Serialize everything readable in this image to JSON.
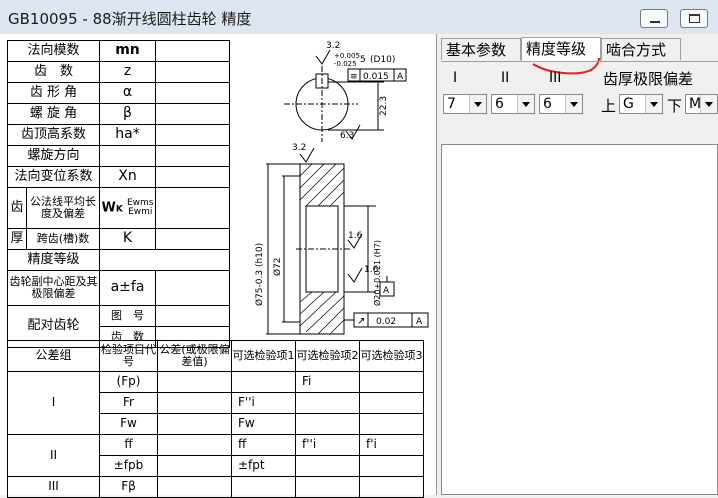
{
  "window": {
    "title": "GB10095 - 88渐开线圆柱齿轮 精度"
  },
  "spec_table": {
    "rows": [
      {
        "label": "法向模数",
        "symbol": "mn"
      },
      {
        "label": "齿　数",
        "symbol": "z"
      },
      {
        "label": "齿 形 角",
        "symbol": "α"
      },
      {
        "label": "螺 旋 角",
        "symbol": "β"
      },
      {
        "label": "齿顶高系数",
        "symbol": "ha*"
      },
      {
        "label": "螺旋方向",
        "symbol": ""
      },
      {
        "label": "法向变位系数",
        "symbol": "Xn"
      }
    ],
    "tooth_label_1": "齿",
    "tooth_label_2": "厚",
    "wk_label": "公法线平均长度及偏差",
    "wk_symbol": "W",
    "wk_sub": "K",
    "wk_ews": "Ewms",
    "wk_ewi": "Ewmi",
    "span_label": "跨齿(槽)数",
    "span_symbol": "K",
    "accuracy_label": "精度等级",
    "center_label": "齿轮副中心距及其极限偏差",
    "center_symbol": "a±fa",
    "mating_label": "配对齿轮",
    "drawing_no": "图　号",
    "teeth_count": "齿　数"
  },
  "tolerance_table": {
    "headers": [
      "公差组",
      "检验项目代号",
      "公差(或极限偏差值)",
      "可选检验项1",
      "可选检验项2",
      "可选检验项3"
    ],
    "groups": [
      {
        "name": "I",
        "items": [
          {
            "code": "(Fp)",
            "opt1": "",
            "opt2": "Fi",
            "opt3": ""
          },
          {
            "code": "Fr",
            "opt1": "F''i",
            "opt2": "",
            "opt3": ""
          },
          {
            "code": "Fw",
            "opt1": "Fw",
            "opt2": "",
            "opt3": ""
          }
        ]
      },
      {
        "name": "II",
        "items": [
          {
            "code": "ff",
            "opt1": "ff",
            "opt2": "f''i",
            "opt3": "f'i"
          },
          {
            "code": "±fpb",
            "opt1": "±fpt",
            "opt2": "",
            "opt3": ""
          }
        ]
      },
      {
        "name": "III",
        "items": [
          {
            "code": "Fβ",
            "opt1": "",
            "opt2": "",
            "opt3": ""
          }
        ]
      }
    ]
  },
  "drawing": {
    "roughness_1": "3.2",
    "roughness_2": "3.2",
    "roughness_3": "6.3",
    "roughness_4": "1.6",
    "roughness_5": "1.6",
    "tol_upper": "+0.005",
    "tol_lower": "-0.025",
    "keyway_dim": "5",
    "keyway_fit": "(D10)",
    "sym_tol": "0.015",
    "datum": "A",
    "dim_223": "22.3",
    "dim_d_tip": "Ø75-0.3 (h10)",
    "dim_d_72": "Ø72",
    "dim_bore": "Ø20+0.021 (H7)",
    "runout_tol": "0.02",
    "runout_datum": "A",
    "datum_box": "A"
  },
  "tabs": [
    {
      "label": "基本参数",
      "active": false
    },
    {
      "label": "精度等级",
      "active": true
    },
    {
      "label": "啮合方式",
      "active": false
    }
  ],
  "accuracy_panel": {
    "col_labels": [
      "I",
      "II",
      "III"
    ],
    "grade_values": [
      "7",
      "6",
      "6"
    ],
    "thickness_label": "齿厚极限偏差",
    "upper_label": "上",
    "upper_value": "G",
    "lower_label": "下",
    "lower_value": "M"
  },
  "annotation_color": "#e0201c"
}
